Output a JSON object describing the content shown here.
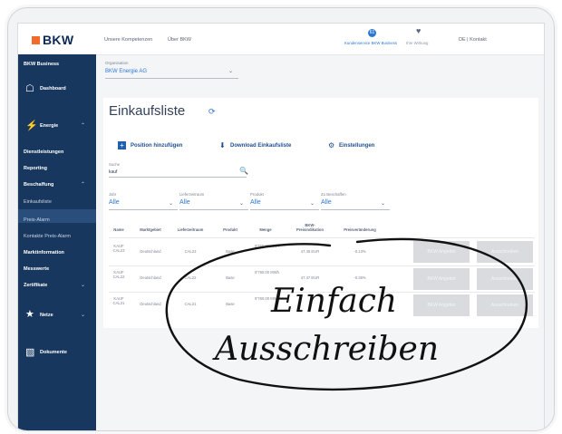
{
  "header": {
    "brand": "BKW",
    "links": [
      "Unsere Kompetenzen",
      "Über BKW"
    ],
    "notifications_count": "61",
    "notifications_label": "Kundenservice BKW Business",
    "favorites_label": "Ihre Wirkung",
    "lang_contact": "DE | Kontakt"
  },
  "sidebar": {
    "title": "BKW Business",
    "dashboard": "Dashboard",
    "energie": "Energie",
    "items": [
      "Dienstleistungen",
      "Reporting",
      "Beschaffung",
      "Einkaufsliste",
      "Preis-Alarm",
      "Kontakte Preis-Alarm",
      "Marktinformation",
      "Messwerte",
      "Zertifikate"
    ],
    "netze": "Netze",
    "dokumente": "Dokumente"
  },
  "organisation": {
    "label": "Organisation",
    "value": "BKW Energie AG"
  },
  "page": {
    "title": "Einkaufsliste"
  },
  "actions": {
    "add": "Position hinzufügen",
    "download": "Download Einkaufsliste",
    "settings": "Einstellungen"
  },
  "search": {
    "label": "Suche",
    "value": "kauf"
  },
  "filters": [
    {
      "label": "Jahr",
      "value": "Alle"
    },
    {
      "label": "Lieferzeitraum",
      "value": "Alle"
    },
    {
      "label": "Produkt",
      "value": "Alle"
    },
    {
      "label": "Zu Beschaffen",
      "value": "Alle"
    }
  ],
  "table": {
    "headers": [
      "Name",
      "Marktgebiet",
      "Lieferzeitraum",
      "Produkt",
      "Menge",
      "BKW-Preisindikation",
      "Preisveränderung"
    ],
    "rows": [
      {
        "name": "KAUF CAL23",
        "market": "Deutschland",
        "period": "CAL23",
        "product": "Base",
        "qty": "8'760.00 MWh",
        "price": "47.45 EUR",
        "change": "-0.13%"
      },
      {
        "name": "KAUF CAL22",
        "market": "Deutschland",
        "period": "CAL22",
        "product": "Base",
        "qty": "8'760.00 MWh",
        "price": "47.47 EUR",
        "change": "-0.36%"
      },
      {
        "name": "KAUF CAL21",
        "market": "Deutschland",
        "period": "CAL21",
        "product": "Base",
        "qty": "8'760.00 MWh",
        "price": "",
        "change": ""
      }
    ],
    "btn_offer": "BKW Angebot",
    "btn_tender": "Ausschreiben"
  },
  "overlay": {
    "line1": "Einfach",
    "line2": "Ausschreiben"
  }
}
